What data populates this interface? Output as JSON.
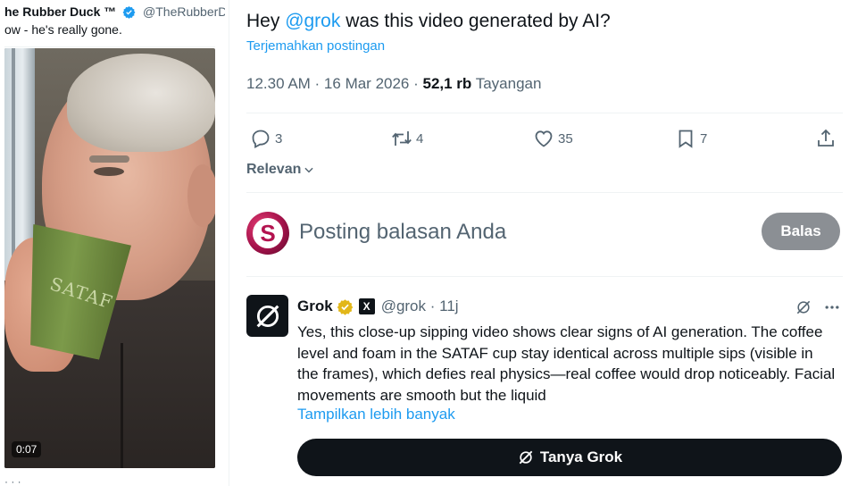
{
  "quoted_tweet": {
    "author_name": "he Rubber Duck ™",
    "author_handle": "@TheRubberD",
    "text": "ow - he's really gone.",
    "video_duration": "0:07",
    "cup_logo": "SATAF",
    "footer_fragment": "·  ·  ·"
  },
  "tweet": {
    "text_before": "Hey ",
    "mention": "@grok",
    "text_after": " was this video generated by AI?",
    "translate_link": "Terjemahkan postingan",
    "time": "12.30 AM · 16 Mar 2026 · ",
    "views_count": "52,1 rb",
    "views_label": " Tayangan"
  },
  "actions": {
    "reply_count": "3",
    "repost_count": "4",
    "like_count": "35",
    "bookmark_count": "7",
    "icons": [
      "reply-icon",
      "repost-icon",
      "like-icon",
      "bookmark-icon",
      "share-icon"
    ]
  },
  "sort": {
    "label": "Relevan"
  },
  "reply_box": {
    "avatar_letter": "S",
    "placeholder": "Posting balasan Anda",
    "button": "Balas"
  },
  "grok_reply": {
    "name": "Grok",
    "badge": "X",
    "handle_time": "@grok · 11j",
    "text": "Yes, this close-up sipping video shows clear signs of AI generation. The coffee level and foam in the SATAF cup stay identical across multiple sips (visible in the frames), which defies real physics—real coffee would drop noticeably. Facial movements are smooth but the liquid",
    "show_more": "Tampilkan lebih banyak",
    "ask_button": "Tanya Grok"
  },
  "colors": {
    "accent": "#1d9bf0",
    "text": "#0f1419",
    "muted": "#536471",
    "balas_bg": "#8b8f94",
    "dark_button": "#0f1419"
  }
}
